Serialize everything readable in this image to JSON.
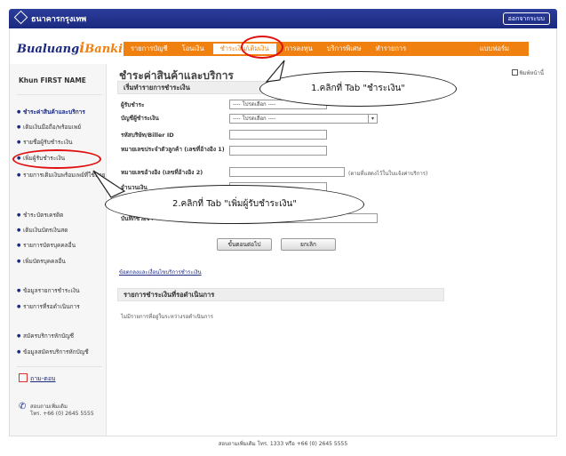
{
  "header": {
    "bank_name": "ธนาคารกรุงเทพ",
    "logout_label": "ออกจากระบบ"
  },
  "brand": {
    "part1": "Bualuang",
    "part2": "i",
    "part3": "Banking"
  },
  "tabs": [
    {
      "label": "รายการบัญชี"
    },
    {
      "label": "โอนเงิน"
    },
    {
      "label": "ชำระเงิน/เติมเงิน"
    },
    {
      "label": "การลงทุน"
    },
    {
      "label": "บริการพิเศษ"
    },
    {
      "label": "ทำรายการ"
    },
    {
      "label": "แบบฟอร์ม"
    }
  ],
  "sidebar": {
    "username": "Khun FIRST NAME",
    "items": [
      {
        "label": "ชำระค่าสินค้าและบริการ"
      },
      {
        "label": "เติมเงินมือถือ/พร้อมเพย์"
      },
      {
        "label": "รายชื่อผู้รับชำระเงิน"
      },
      {
        "label": "เพิ่มผู้รับชำระเงิน"
      },
      {
        "label": "รายการเติมเงินพร้อมเพย์ที่ใช้บ่อย"
      },
      {
        "label": "ชำระบัตรเครดิต"
      },
      {
        "label": "เติมเงินบัตรเงินสด"
      },
      {
        "label": "รายการบัตรบุคคลอื่น"
      },
      {
        "label": "เพิ่มบัตรบุคคลอื่น"
      },
      {
        "label": "ข้อมูลรายการชำระเงิน"
      },
      {
        "label": "รายการที่รอดำเนินการ"
      },
      {
        "label": "สมัครบริการหักบัญชี"
      },
      {
        "label": "ข้อมูลสมัครบริการหักบัญชี"
      }
    ],
    "help_label": "ถาม-ตอบ",
    "contact_line1": "สอบถามเพิ่มเติม",
    "contact_line2": "โทร. +66 (0) 2645 5555"
  },
  "main": {
    "title": "ชำระค่าสินค้าและบริการ",
    "print_label": "พิมพ์หน้านี้",
    "section1_title": "เริ่มทำรายการชำระเงิน",
    "fields": {
      "payee_label": "ผู้รับชำระ",
      "payee_value": "---- โปรดเลือก ----",
      "account_label": "บัญชีผู้ชำระเงิน",
      "account_value": "---- โปรดเลือก ----",
      "biller_label": "รหัสบริษัท/Biller ID",
      "ref1_label": "หมายเลขประจำตัวลูกค้า (เลขที่อ้างอิง 1)",
      "ref2_label": "หมายเลขอ้างอิง (เลขที่อ้างอิง 2)",
      "amount_label": "จำนวนเงิน",
      "amount_note": "(ตามที่แสดงไว้ในใบแจ้งค่าบริการ)",
      "note_label": "บันทึกช่วยจำ"
    },
    "next_button": "ขั้นตอนต่อไป",
    "cancel_button": "ยกเลิก",
    "terms_link": "ข้อตกลงและเงื่อนไขบริการชำระเงิน",
    "section2_title": "รายการชำระเงินที่รอดำเนินการ",
    "pending_note": "ไม่มีรายการที่อยู่ในระหว่างรอดำเนินการ"
  },
  "annotations": {
    "step1": "1.คลิกที่ Tab \"ชำระเงิน\"",
    "step2": "2.คลิกที่ Tab \"เพิ่มผู้รับชำระเงิน\""
  },
  "footer": {
    "text": "สอบถามเพิ่มเติม โทร. 1333 หรือ +66 (0) 2645 5555"
  },
  "colors": {
    "brand_blue": "#1b2a80",
    "brand_orange": "#f08010",
    "annotation_red": "#e01010"
  }
}
